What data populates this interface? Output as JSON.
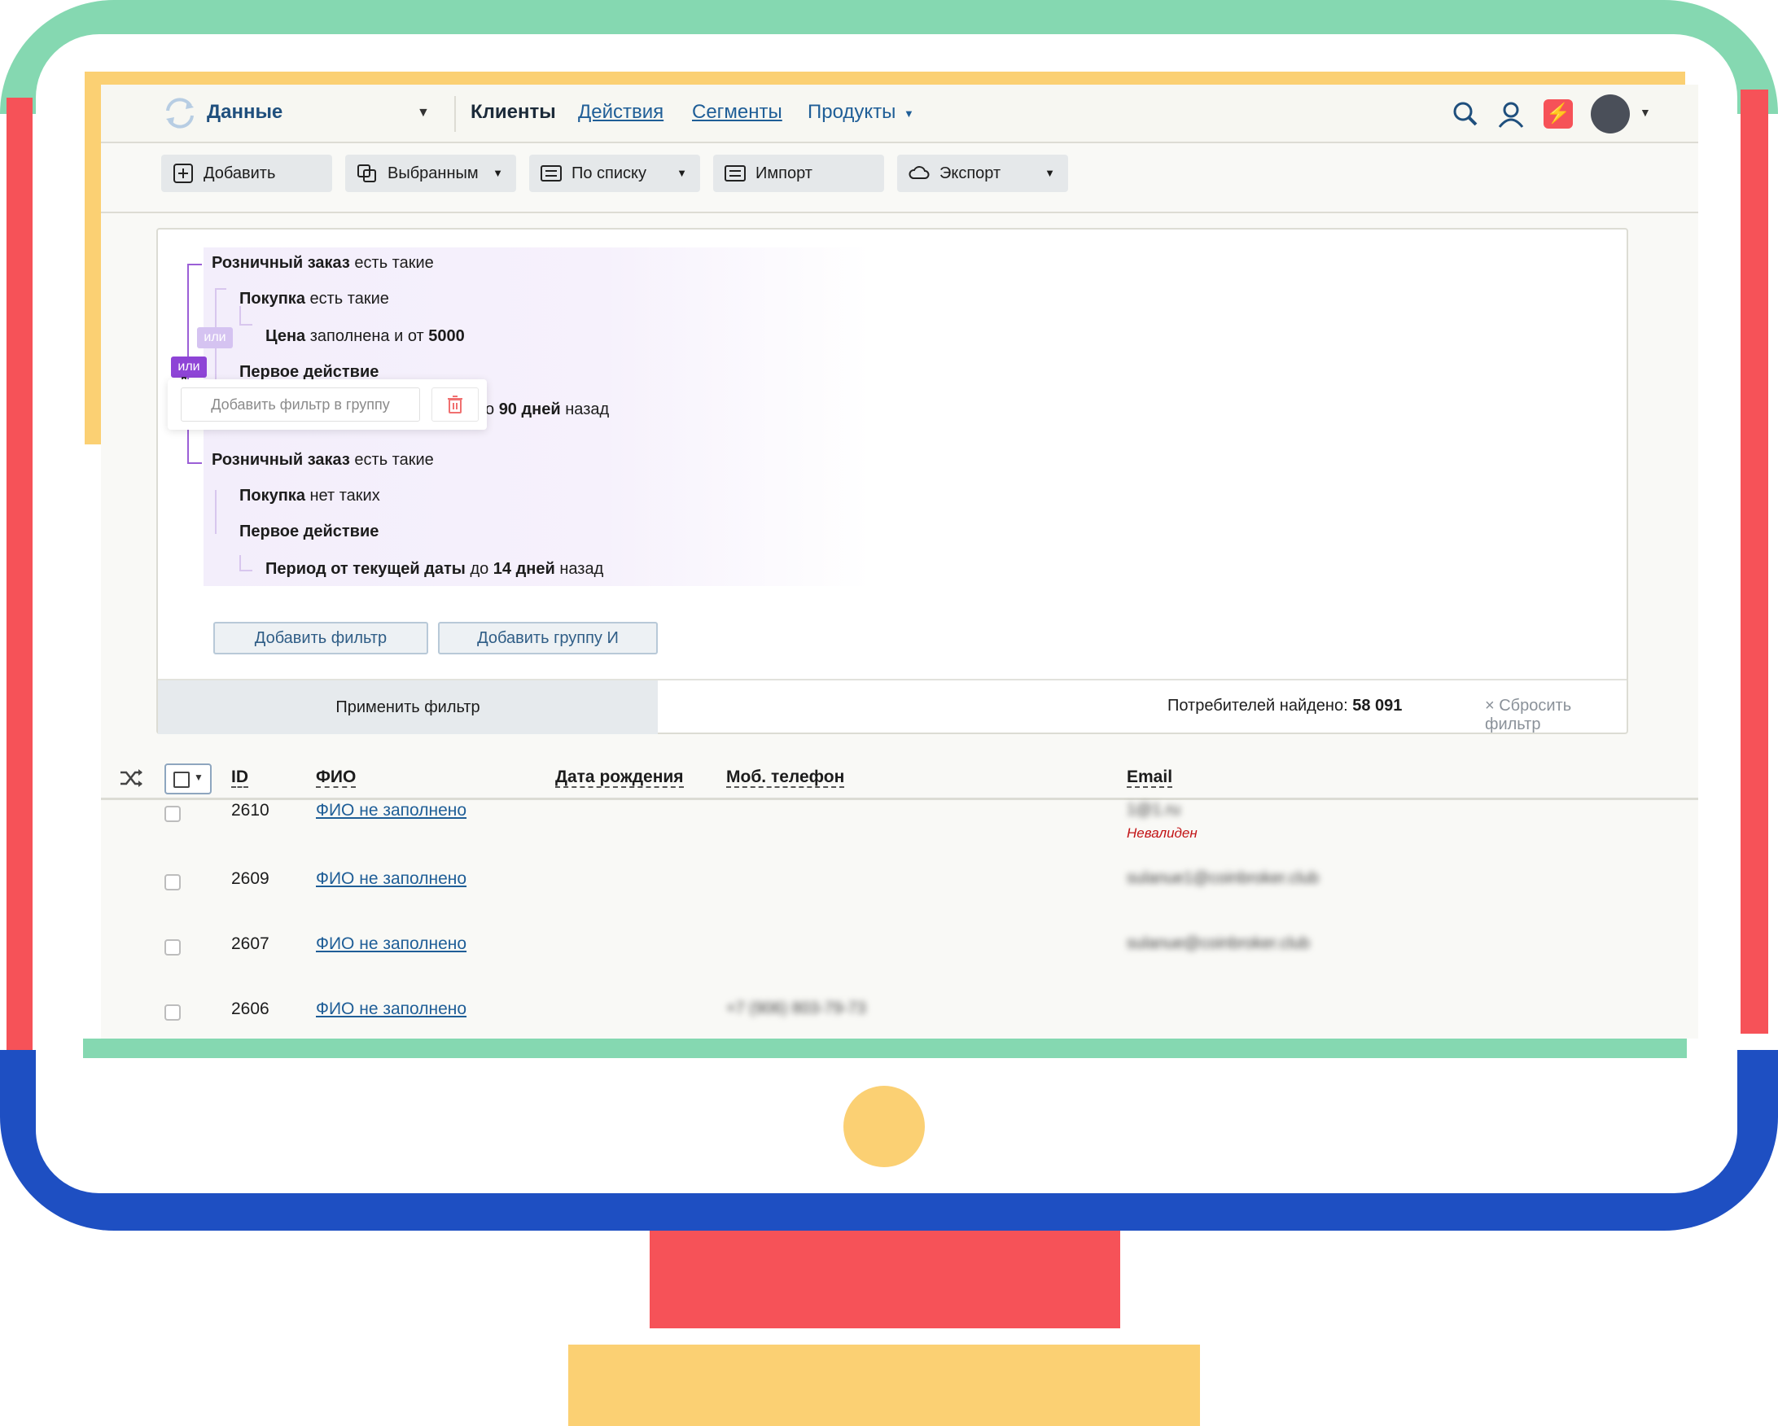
{
  "header": {
    "brand": "Данные",
    "nav": [
      "Клиенты",
      "Действия",
      "Сегменты",
      "Продукты"
    ],
    "icons": [
      "search-icon",
      "support-icon",
      "bolt-icon",
      "avatar"
    ]
  },
  "toolbar": {
    "add": "Добавить",
    "selected": "Выбранным",
    "by_list": "По списку",
    "import": "Импорт",
    "export": "Экспорт"
  },
  "filter": {
    "g1_l1_b": "Розничный заказ",
    "g1_l1_t": " есть такие",
    "g1_l2_b": "Покупка",
    "g1_l2_t": " есть такие",
    "g1_l3_b": "Цена",
    "g1_l3_t": " заполнена и от ",
    "g1_l3_v": "5000",
    "g1_l4_b": "Первое действие",
    "g1_l5_t": "о ",
    "g1_l5_b": "90 дней",
    "g1_l5_t2": " назад",
    "g2_l1_b": "Розничный заказ",
    "g2_l1_t": " есть такие",
    "g2_l2_b": "Покупка",
    "g2_l2_t": " нет таких",
    "g2_l3_b": "Первое действие",
    "g2_l4_b": "Период от текущей даты",
    "g2_l4_t": " до ",
    "g2_l4_b2": "14 дней",
    "g2_l4_t2": " назад",
    "ili": "или",
    "popup_add": "Добавить фильтр в группу",
    "add_filter": "Добавить фильтр",
    "add_group": "Добавить группу И",
    "apply": "Применить фильтр",
    "found_label": "Потребителей найдено: ",
    "found_value": "58 091",
    "reset": "× Сбросить фильтр"
  },
  "table": {
    "headers": [
      "ID",
      "ФИО",
      "Дата рождения",
      "Моб. телефон",
      "Email"
    ],
    "rows": [
      {
        "id": "2610",
        "name": "ФИО не заполнено",
        "phone": "",
        "email": "1@1.ru",
        "note": "Невалиден"
      },
      {
        "id": "2609",
        "name": "ФИО не заполнено",
        "phone": "",
        "email": "sulanue1@coinbroker.club",
        "note": ""
      },
      {
        "id": "2607",
        "name": "ФИО не заполнено",
        "phone": "",
        "email": "sulanue@coinbroker.club",
        "note": ""
      },
      {
        "id": "2606",
        "name": "ФИО не заполнено",
        "phone": "+7 (906) 803-79-73",
        "email": "",
        "note": ""
      }
    ]
  },
  "colors": {
    "accent_purple": "#9b5fd6",
    "link_blue": "#1f5e97",
    "frame_green": "#85d8b1",
    "frame_red": "#f65258",
    "frame_blue": "#1e4fc2",
    "frame_yellow": "#fbd073"
  }
}
